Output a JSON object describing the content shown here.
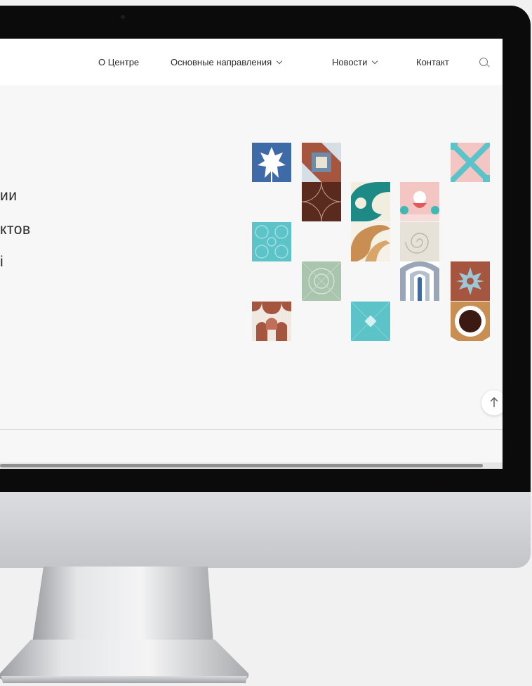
{
  "nav": {
    "items": [
      {
        "label": "О Центре",
        "has_dropdown": false
      },
      {
        "label": "Основные направления",
        "has_dropdown": true
      },
      {
        "label": "Новости",
        "has_dropdown": true
      },
      {
        "label": "Контакт",
        "has_dropdown": false
      }
    ],
    "search_icon": "search-icon"
  },
  "hero": {
    "lines": [
      "ии",
      "ктов",
      "і"
    ]
  },
  "colors": {
    "screen_bg": "#f7f7f7",
    "nav_bg": "#ffffff",
    "bezel": "#0b0b0b",
    "tile_blue": "#3f6aa8",
    "tile_brown": "#5a2a1e",
    "tile_rust": "#a6553f",
    "tile_teal": "#5cc3c8",
    "tile_pink": "#f3c6c4",
    "tile_sage": "#a9c5ae",
    "tile_cream": "#f2eedf",
    "tile_tan": "#c98f52"
  },
  "tiles": [
    {
      "name": "blue-leaf-tile"
    },
    {
      "name": "geometric-tile"
    },
    {
      "name": "brown-circles-tile"
    },
    {
      "name": "green-wave-tile"
    },
    {
      "name": "pink-ornament-tile"
    },
    {
      "name": "pink-cross-tile"
    },
    {
      "name": "teal-spiral-tile"
    },
    {
      "name": "tan-wave-tile"
    },
    {
      "name": "grey-spiral-tile"
    },
    {
      "name": "sage-circle-tile"
    },
    {
      "name": "arch-stripes-tile"
    },
    {
      "name": "snowflake-tile"
    },
    {
      "name": "rust-shapes-tile"
    },
    {
      "name": "teal-diamond-tile"
    },
    {
      "name": "dark-circle-tile"
    }
  ],
  "scroll_top_icon": "arrow-up-icon"
}
